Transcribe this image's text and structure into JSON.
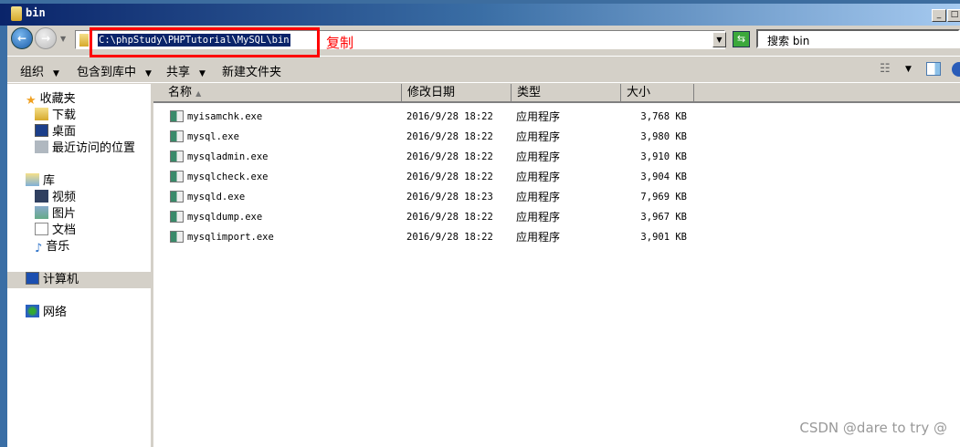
{
  "window": {
    "title": "bin",
    "minimize": "_",
    "maximize": "□"
  },
  "address": {
    "path": "C:\\phpStudy\\PHPTutorial\\MySQL\\bin",
    "annotation": "复制"
  },
  "search": {
    "placeholder": "搜索 bin"
  },
  "toolbar": {
    "organize": "组织",
    "include_library": "包含到库中",
    "share": "共享",
    "new_folder": "新建文件夹"
  },
  "sidebar": {
    "favorites": "收藏夹",
    "downloads": "下载",
    "desktop": "桌面",
    "recent": "最近访问的位置",
    "libraries": "库",
    "videos": "视频",
    "pictures": "图片",
    "documents": "文档",
    "music": "音乐",
    "computer": "计算机",
    "network": "网络"
  },
  "columns": {
    "name": "名称",
    "date": "修改日期",
    "type": "类型",
    "size": "大小"
  },
  "files": [
    {
      "name": "myisamchk.exe",
      "date": "2016/9/28 18:22",
      "type": "应用程序",
      "size": "3,768 KB"
    },
    {
      "name": "mysql.exe",
      "date": "2016/9/28 18:22",
      "type": "应用程序",
      "size": "3,980 KB"
    },
    {
      "name": "mysqladmin.exe",
      "date": "2016/9/28 18:22",
      "type": "应用程序",
      "size": "3,910 KB"
    },
    {
      "name": "mysqlcheck.exe",
      "date": "2016/9/28 18:22",
      "type": "应用程序",
      "size": "3,904 KB"
    },
    {
      "name": "mysqld.exe",
      "date": "2016/9/28 18:23",
      "type": "应用程序",
      "size": "7,969 KB"
    },
    {
      "name": "mysqldump.exe",
      "date": "2016/9/28 18:22",
      "type": "应用程序",
      "size": "3,967 KB"
    },
    {
      "name": "mysqlimport.exe",
      "date": "2016/9/28 18:22",
      "type": "应用程序",
      "size": "3,901 KB"
    }
  ],
  "watermark": "CSDN @dare to try @"
}
